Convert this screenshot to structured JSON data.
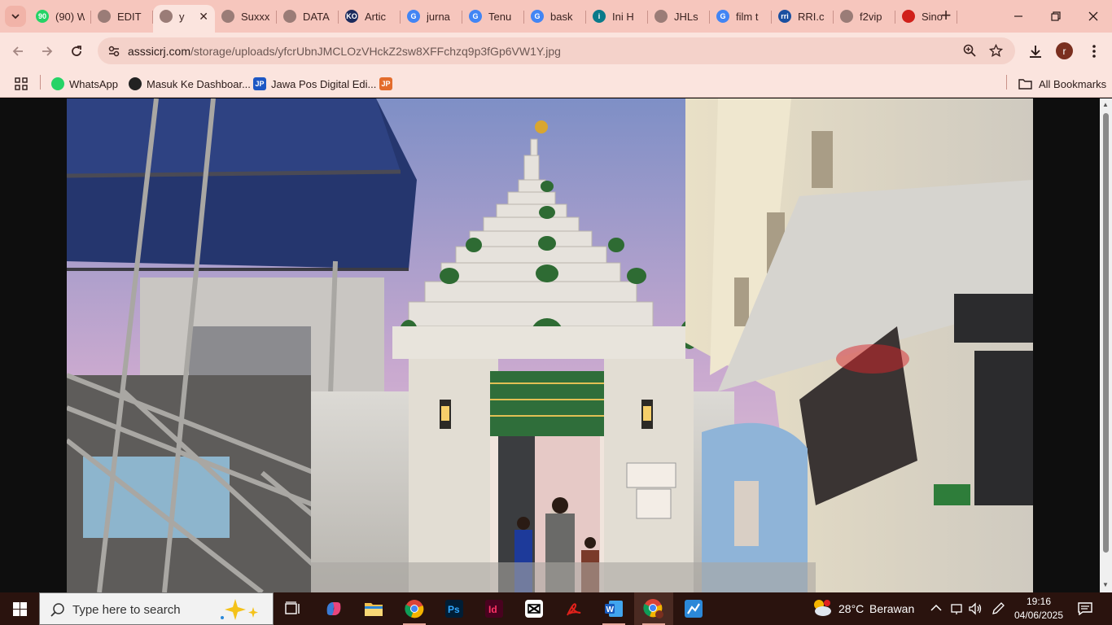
{
  "tabs": [
    {
      "title": "(90) W",
      "favicon": "whatsapp-icon",
      "color": "#25d366",
      "fav_text": "90"
    },
    {
      "title": "EDIT",
      "favicon": "globe-icon",
      "color": "#9a7c77",
      "fav_text": ""
    },
    {
      "title": "y",
      "favicon": "globe-icon",
      "color": "#9a7c77",
      "fav_text": "",
      "active": true
    },
    {
      "title": "Suxxx",
      "favicon": "globe-icon",
      "color": "#9a7c77",
      "fav_text": ""
    },
    {
      "title": "DATA",
      "favicon": "globe-icon",
      "color": "#9a7c77",
      "fav_text": ""
    },
    {
      "title": "Artic",
      "favicon": "ko-icon",
      "color": "#1b2a5c",
      "fav_text": "KO"
    },
    {
      "title": "jurna",
      "favicon": "google-icon",
      "color": "#4285f4",
      "fav_text": "G"
    },
    {
      "title": "Tenu",
      "favicon": "google-icon",
      "color": "#4285f4",
      "fav_text": "G"
    },
    {
      "title": "bask",
      "favicon": "google-icon",
      "color": "#4285f4",
      "fav_text": "G"
    },
    {
      "title": "Ini H",
      "favicon": "site-icon",
      "color": "#0a7a8a",
      "fav_text": "i"
    },
    {
      "title": "JHLs",
      "favicon": "globe-icon",
      "color": "#9a7c77",
      "fav_text": ""
    },
    {
      "title": "film t",
      "favicon": "google-icon",
      "color": "#4285f4",
      "fav_text": "G"
    },
    {
      "title": "RRI.c",
      "favicon": "rri-icon",
      "color": "#1a4fa0",
      "fav_text": "rri"
    },
    {
      "title": "f2vip",
      "favicon": "globe-icon",
      "color": "#9a7c77",
      "fav_text": ""
    },
    {
      "title": "Sino",
      "favicon": "pin-icon",
      "color": "#d0201a",
      "fav_text": ""
    }
  ],
  "toolbar": {
    "url_host": "asssicrj.com",
    "url_path": "/storage/uploads/yfcrUbnJMCLOzVHckZ2sw8XFFchzq9p3fGp6VW1Y.jpg",
    "profile_initial": "r"
  },
  "bookmarks": [
    {
      "label": "WhatsApp",
      "icon": "whatsapp-icon",
      "color": "#25d366",
      "ico_text": ""
    },
    {
      "label": "Masuk Ke Dashboar...",
      "icon": "dashboard-icon",
      "color": "#222222",
      "ico_text": ""
    },
    {
      "label": "Jawa Pos Digital Edi...",
      "icon": "jp-icon",
      "color": "#1d57c4",
      "ico_text": "JP"
    },
    {
      "label": "",
      "icon": "jp-small-icon",
      "color": "#e36c2c",
      "ico_text": "JP"
    }
  ],
  "all_bookmarks": "All Bookmarks",
  "taskbar": {
    "search_placeholder": "Type here to search",
    "weather_temp": "28°C",
    "weather_desc": "Berawan",
    "time": "19:16",
    "date": "04/06/2025"
  },
  "colors": {
    "tabstrip": "#f6c6bd",
    "toolbar": "#fbe4de",
    "taskbar": "#2a130e"
  }
}
